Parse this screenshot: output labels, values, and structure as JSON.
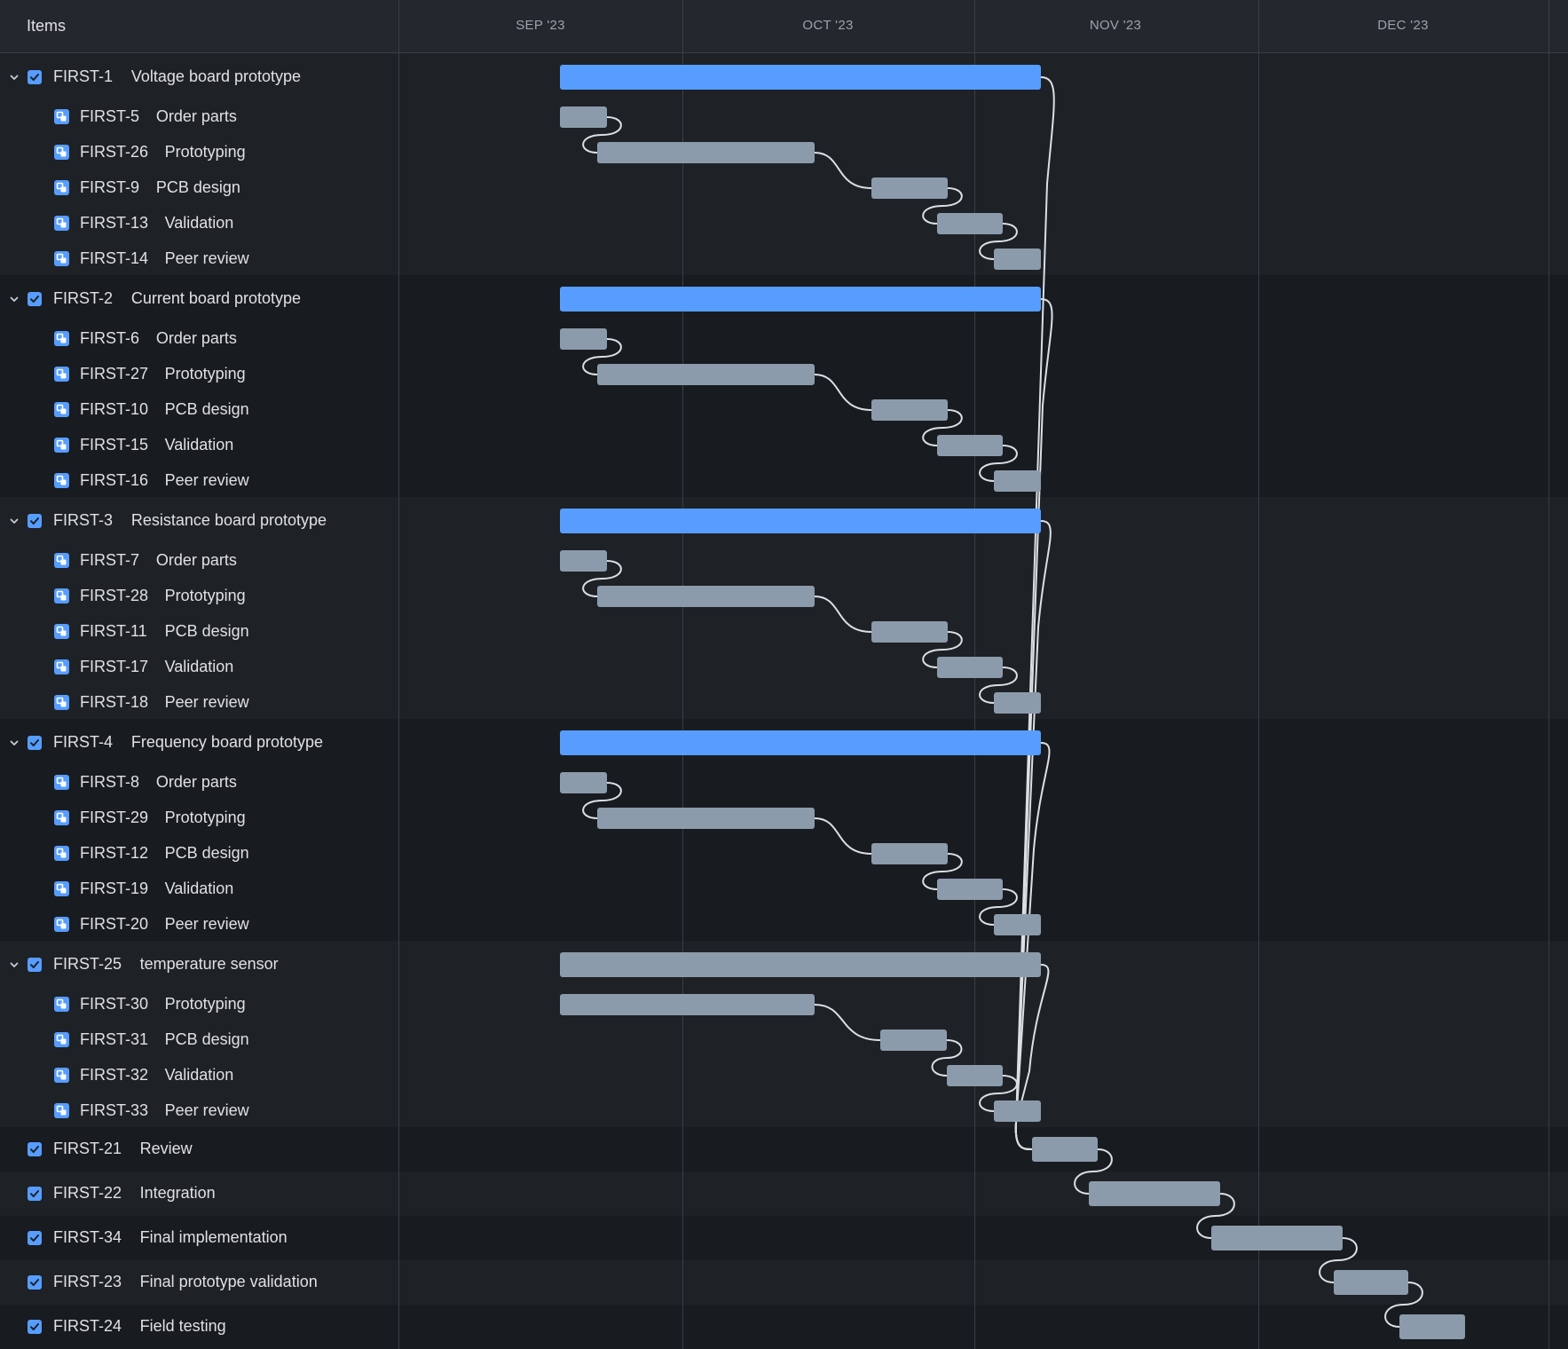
{
  "header": {
    "items_label": "Items",
    "months": [
      "SEP '23",
      "OCT '23",
      "NOV '23",
      "DEC '23"
    ]
  },
  "colors": {
    "epic_bar": "#579dff",
    "task_bar": "#8c9bab",
    "link": "#dcdfe4",
    "checkbox": "#579dff"
  },
  "groups": [
    {
      "key": "FIRST-1",
      "summary": "Voltage board prototype",
      "expanded": true,
      "children": [
        {
          "key": "FIRST-5",
          "summary": "Order parts"
        },
        {
          "key": "FIRST-26",
          "summary": "Prototyping"
        },
        {
          "key": "FIRST-9",
          "summary": "PCB design"
        },
        {
          "key": "FIRST-13",
          "summary": "Validation"
        },
        {
          "key": "FIRST-14",
          "summary": "Peer review"
        }
      ]
    },
    {
      "key": "FIRST-2",
      "summary": "Current board prototype",
      "expanded": true,
      "children": [
        {
          "key": "FIRST-6",
          "summary": "Order parts"
        },
        {
          "key": "FIRST-27",
          "summary": "Prototyping"
        },
        {
          "key": "FIRST-10",
          "summary": "PCB design"
        },
        {
          "key": "FIRST-15",
          "summary": "Validation"
        },
        {
          "key": "FIRST-16",
          "summary": "Peer review"
        }
      ]
    },
    {
      "key": "FIRST-3",
      "summary": "Resistance board prototype",
      "expanded": true,
      "children": [
        {
          "key": "FIRST-7",
          "summary": "Order parts"
        },
        {
          "key": "FIRST-28",
          "summary": "Prototyping"
        },
        {
          "key": "FIRST-11",
          "summary": "PCB design"
        },
        {
          "key": "FIRST-17",
          "summary": "Validation"
        },
        {
          "key": "FIRST-18",
          "summary": "Peer review"
        }
      ]
    },
    {
      "key": "FIRST-4",
      "summary": "Frequency board prototype",
      "expanded": true,
      "children": [
        {
          "key": "FIRST-8",
          "summary": "Order parts"
        },
        {
          "key": "FIRST-29",
          "summary": "Prototyping"
        },
        {
          "key": "FIRST-12",
          "summary": "PCB design"
        },
        {
          "key": "FIRST-19",
          "summary": "Validation"
        },
        {
          "key": "FIRST-20",
          "summary": "Peer review"
        }
      ]
    },
    {
      "key": "FIRST-25",
      "summary": "temperature sensor",
      "expanded": true,
      "children": [
        {
          "key": "FIRST-30",
          "summary": "Prototyping"
        },
        {
          "key": "FIRST-31",
          "summary": "PCB design"
        },
        {
          "key": "FIRST-32",
          "summary": "Validation"
        },
        {
          "key": "FIRST-33",
          "summary": "Peer review"
        }
      ]
    }
  ],
  "standalone": [
    {
      "key": "FIRST-21",
      "summary": "Review"
    },
    {
      "key": "FIRST-22",
      "summary": "Integration"
    },
    {
      "key": "FIRST-34",
      "summary": "Final implementation"
    },
    {
      "key": "FIRST-23",
      "summary": "Final prototype validation"
    },
    {
      "key": "FIRST-24",
      "summary": "Field testing"
    }
  ]
}
